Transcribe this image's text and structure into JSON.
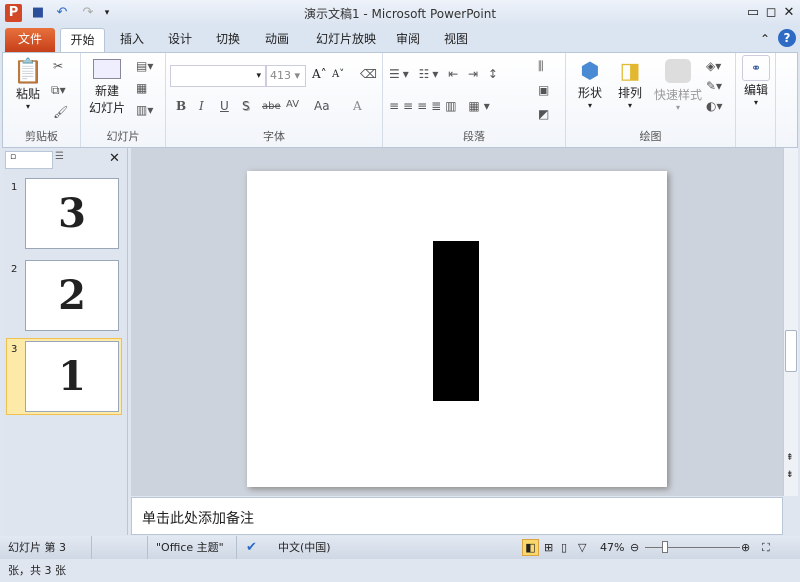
{
  "window": {
    "title": "演示文稿1 - Microsoft PowerPoint",
    "app_icon": "P"
  },
  "quick_access": {
    "save": "save-icon",
    "undo": "↶",
    "redo": "↷"
  },
  "tabs": [
    "文件",
    "开始",
    "插入",
    "设计",
    "切换",
    "动画",
    "幻灯片放映",
    "审阅",
    "视图"
  ],
  "ribbon": {
    "clipboard": {
      "label": "剪贴板",
      "paste": "粘贴"
    },
    "slides": {
      "label": "幻灯片",
      "new_slide_1": "新建",
      "new_slide_2": "幻灯片"
    },
    "font": {
      "label": "字体",
      "font_name": "",
      "font_size": "413",
      "bold": "B",
      "italic": "I",
      "underline": "U",
      "shadow": "S",
      "strike": "abe",
      "spacing": "AV",
      "case": "Aa",
      "color": "A",
      "grow": "A",
      "shrink": "A"
    },
    "paragraph": {
      "label": "段落"
    },
    "drawing": {
      "label": "绘图",
      "shapes": "形状",
      "arrange": "排列",
      "quick_styles": "快速样式"
    },
    "editing": {
      "label": "编辑"
    }
  },
  "slides": [
    {
      "num": "1",
      "content": "3"
    },
    {
      "num": "2",
      "content": "2"
    },
    {
      "num": "3",
      "content": "1"
    }
  ],
  "current_slide": {
    "content": "1"
  },
  "notes": {
    "placeholder": "单击此处添加备注"
  },
  "status": {
    "slide_info": "幻灯片 第 3 张，共 3 张",
    "theme": "\"Office 主题\"",
    "language": "中文(中国)",
    "zoom": "47%",
    "zoom_value": 47
  }
}
